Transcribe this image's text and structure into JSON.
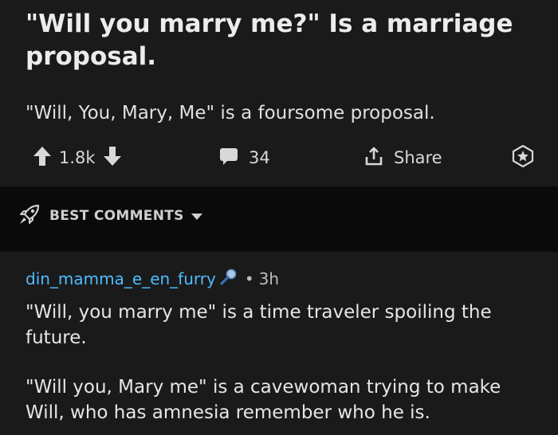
{
  "post": {
    "title": "\"Will you marry me?\" Is a marriage proposal.",
    "body": "\"Will, You, Mary, Me\" is a foursome proposal.",
    "vote_count": "1.8k",
    "comment_count": "34",
    "share_label": "Share",
    "icons": {
      "upvote": "arrow-up-icon",
      "downvote": "arrow-down-icon",
      "comments": "speech-bubble-icon",
      "share": "share-icon",
      "award": "award-star-icon"
    }
  },
  "sort": {
    "label": "BEST COMMENTS",
    "icons": {
      "sort": "rocket-icon",
      "dropdown": "chevron-down-icon"
    }
  },
  "comment": {
    "username": "din_mamma_e_en_furry",
    "time": "3h",
    "paragraphs": [
      "\"Will, you marry me\" is a time traveler spoiling the future.",
      "\"Will you, Mary me\" is a cavewoman trying to make Will, who has amnesia remember who he is."
    ],
    "icons": {
      "flair": "magnifier-flair-icon"
    }
  },
  "colors": {
    "background": "#000000",
    "card": "#1a1a1b",
    "sort_bar": "#0a0a0a",
    "username": "#4fbcff",
    "text": "#e6e6e6"
  }
}
